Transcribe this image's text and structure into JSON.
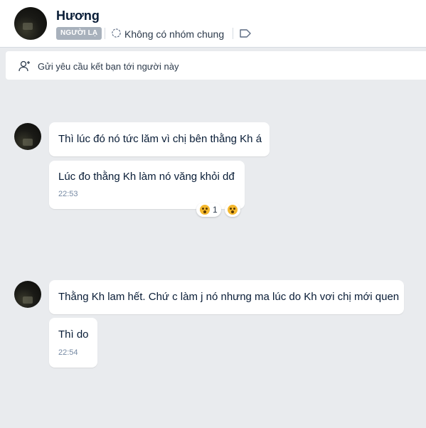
{
  "header": {
    "name": "Hương",
    "badge": "NGƯỜI LẠ",
    "common_group": "Không có nhóm chung"
  },
  "friend_request": {
    "label": "Gửi yêu cầu kết bạn tới người này"
  },
  "messages": [
    {
      "text": "Thì lúc đó nó tức lăm vì chị bên thằng Kh á"
    },
    {
      "text": "Lúc đo thằng Kh làm nó văng khỏi dđ",
      "time": "22:53",
      "reaction_count": "1"
    },
    {
      "text": "Thằng Kh lam hết. Chứ c làm j nó nhưng ma lúc do Kh vơi chị mới quen"
    },
    {
      "text": "Thì do",
      "time": "22:54"
    }
  ],
  "colors": {
    "background": "#e9ebee",
    "bubble": "#ffffff",
    "badge": "#a8b1bc",
    "text": "#081c36",
    "time": "#7589a3"
  },
  "icons": [
    "group-icon",
    "tag-icon",
    "add-user-icon",
    "wow-emoji-icon"
  ]
}
